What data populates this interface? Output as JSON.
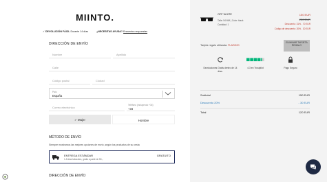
{
  "header": {
    "logo": "MIINTO.",
    "returns_bold": "DEVOLUCIÓN FÁCIL",
    "returns_text": "Durante 14 días",
    "help_bold": "¿NECESITAS AYUDA?",
    "help_link": "Encuentra respuestas"
  },
  "shipping_address": {
    "title": "DIRECCIÓN DE ENVÍO",
    "fields": {
      "first_name": "Nombre",
      "last_name": "Apellido",
      "street": "Calle",
      "postal_code": "Código postal",
      "city": "Ciudad",
      "email": "Correo electrónico"
    },
    "country_label": "País",
    "country_value": "España",
    "phone_label": "Teléfono (incluyendo +34)",
    "phone_value": "+34",
    "gender_options": [
      "Mujer",
      "Hombre"
    ],
    "gender_selected": "Mujer"
  },
  "shipping_method": {
    "title": "MÉTODO DE ENVÍO",
    "subtitle": "Siempre mostramos las mejores opciones de envío, según los productos de su cesta",
    "option_name": "ENTREGA ESTÁNDAR",
    "option_desc": "1-5 días laborales, gratis a partir de 50,-",
    "option_price": "GRATUITO",
    "second_title": "DIRECCIÓN DE ENVÍO"
  },
  "order": {
    "product": {
      "brand": "OFF WHITE",
      "size_label": "Talla: 54 MM",
      "color_label": "Color: black",
      "qty_label": "Cantidad: 1",
      "price": "150 EUR",
      "old_price": "220 EUR",
      "discount_1": "Descuento: 31% - 70 EUR",
      "discount_2": "Código de descuento: 20% - 30 EUR"
    },
    "gift_card_text": "Tarjeta regalo utilizada:",
    "gift_card_code": "FLASH20",
    "remove_gift_label": "ELIMINAR TARJETA REGALO",
    "features": [
      {
        "icon": "refresh-icon",
        "text": "Devoluciones Gratis dentro de 14 días."
      },
      {
        "icon": "stars-icon",
        "text": "4.3 en Trustpilot"
      },
      {
        "icon": "lock-icon",
        "text": "Pago Seguro"
      }
    ],
    "trustpilot_rating": 4.3,
    "summary": {
      "subtotal_label": "Subtotal",
      "subtotal_value": "150 EUR",
      "discount_label": "Descuento 20%",
      "discount_value": "- 30 EUR",
      "total_label": "Total",
      "total_value": "120 EUR"
    }
  },
  "colors": {
    "accent_red": "#c0392b",
    "discount_blue": "#2b7bb9",
    "trustpilot_green": "#00b67a",
    "chat_button": "#1f2a44",
    "sidebar_bg": "#f3f3f3"
  }
}
